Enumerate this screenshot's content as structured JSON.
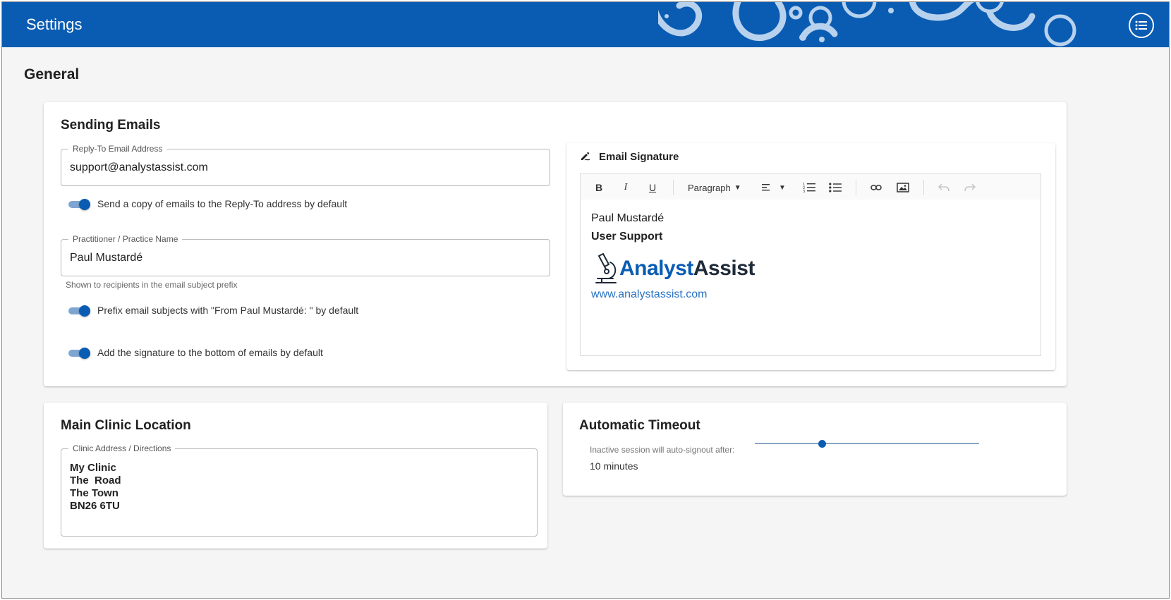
{
  "appbar": {
    "title": "Settings",
    "menu_icon": "list-menu-icon",
    "accent": "#0a5cb3"
  },
  "page": {
    "heading": "General"
  },
  "sending_emails": {
    "title": "Sending Emails",
    "reply_to": {
      "label": "Reply-To Email Address",
      "value": "support@analystassist.com"
    },
    "copy_toggle": {
      "label": "Send a copy of emails to the Reply-To address by default",
      "checked": true
    },
    "practice_name": {
      "label": "Practitioner / Practice Name",
      "value": "Paul Mustardé",
      "helper": "Shown to recipients in the email subject prefix"
    },
    "prefix_toggle": {
      "label": "Prefix email subjects with \"From Paul Mustardé: \" by default",
      "checked": true
    },
    "signature_toggle": {
      "label": "Add the signature to the bottom of emails by default",
      "checked": true
    },
    "signature": {
      "title": "Email Signature",
      "title_icon": "signature-pen-icon",
      "toolbar": {
        "bold": "B",
        "italic": "I",
        "underline": "U",
        "block_format": "Paragraph",
        "align_icon": "align-left-icon",
        "ordered_list_icon": "numbered-list-icon",
        "bullet_list_icon": "bullet-list-icon",
        "link_icon": "link-icon",
        "image_icon": "image-icon",
        "undo_icon": "undo-icon",
        "redo_icon": "redo-icon"
      },
      "content": {
        "name": "Paul Mustardé",
        "role": "User Support",
        "logo_text_1": "Analyst",
        "logo_text_2": "Assist",
        "logo_icon": "microscope-icon",
        "website": "www.analystassist.com"
      }
    }
  },
  "clinic": {
    "title": "Main Clinic Location",
    "address": {
      "label": "Clinic Address / Directions",
      "lines": [
        "My Clinic",
        "The  Road",
        "The Town",
        "BN26 6TU"
      ]
    }
  },
  "timeout": {
    "title": "Automatic Timeout",
    "label": "Inactive session will auto-signout after:",
    "value_text": "10 minutes",
    "slider_fraction": 0.3
  }
}
